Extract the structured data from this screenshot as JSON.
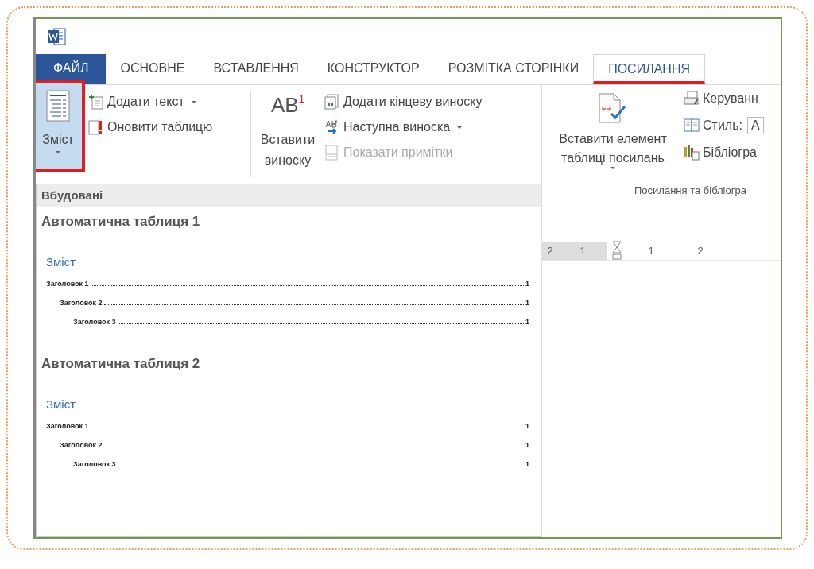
{
  "tabs": [
    {
      "label": "ФАЙЛ",
      "kind": "file",
      "selected": false,
      "annotated": false
    },
    {
      "label": "ОСНОВНЕ",
      "kind": "tab",
      "selected": false,
      "annotated": false
    },
    {
      "label": "ВСТАВЛЕННЯ",
      "kind": "tab",
      "selected": false,
      "annotated": false
    },
    {
      "label": "КОНСТРУКТОР",
      "kind": "tab",
      "selected": false,
      "annotated": false
    },
    {
      "label": "РОЗМІТКА СТОРІНКИ",
      "kind": "tab",
      "selected": false,
      "annotated": false
    },
    {
      "label": "ПОСИЛАННЯ",
      "kind": "tab",
      "selected": true,
      "annotated": true
    }
  ],
  "ribbon": {
    "toc_button": {
      "label": "Зміст",
      "pressed": true,
      "annotated": true
    },
    "toc_commands": [
      {
        "label": "Додати текст",
        "dropdown": true,
        "disabled": false
      },
      {
        "label": "Оновити таблицю",
        "dropdown": false,
        "disabled": false
      }
    ],
    "footnote_button": {
      "icon_text": "AB",
      "icon_mark": "1",
      "lines": [
        "Вставити",
        "виноску"
      ]
    },
    "footnote_commands": [
      {
        "label": "Додати кінцеву виноску",
        "dropdown": false,
        "disabled": false
      },
      {
        "label": "Наступна виноска",
        "dropdown": true,
        "disabled": false
      },
      {
        "label": "Показати примітки",
        "dropdown": false,
        "disabled": true
      }
    ],
    "citation_button": {
      "lines": [
        "Вставити елемент",
        "таблиці посилань"
      ],
      "dropdown": true
    },
    "citation_commands": [
      {
        "label": "Керуванн"
      },
      {
        "label": "Стиль:",
        "value": "A"
      },
      {
        "label": "Бібліогра"
      }
    ],
    "group_label": "Посилання та бібліогра"
  },
  "gallery": {
    "header": "Вбудовані",
    "items": [
      {
        "title": "Автоматична таблиця 1",
        "heading": "Зміст",
        "entries": [
          {
            "text": "Заголовок 1",
            "page": "1",
            "children": [
              {
                "text": "Заголовок 2",
                "page": "1",
                "children": [
                  {
                    "text": "Заголовок 3",
                    "page": "1"
                  }
                ]
              }
            ]
          }
        ]
      },
      {
        "title": "Автоматична таблиця 2",
        "heading": "Зміст",
        "entries": [
          {
            "text": "Заголовок 1",
            "page": "1",
            "children": [
              {
                "text": "Заголовок 2",
                "page": "1",
                "children": [
                  {
                    "text": "Заголовок 3",
                    "page": "1"
                  }
                ]
              }
            ]
          }
        ]
      }
    ]
  },
  "ruler": {
    "marks": [
      {
        "label": "2",
        "margin": true
      },
      {
        "label": "1",
        "margin": true
      },
      {
        "label": "1",
        "margin": false
      },
      {
        "label": "2",
        "margin": false
      }
    ]
  }
}
